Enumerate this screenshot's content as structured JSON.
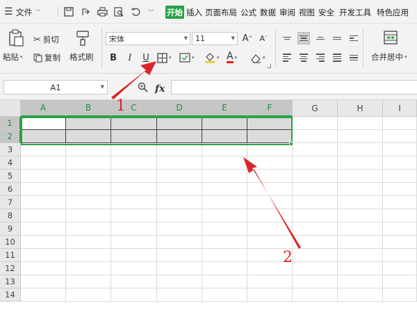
{
  "menubar": {
    "file_label": "文件",
    "tabs": [
      "开始",
      "插入",
      "页面布局",
      "公式",
      "数据",
      "审阅",
      "视图",
      "安全",
      "开发工具",
      "特色应用"
    ],
    "active_tab": "开始"
  },
  "ribbon": {
    "paste_label": "粘贴",
    "cut_label": "剪切",
    "copy_label": "复制",
    "format_painter_label": "格式刷",
    "font_name": "宋体",
    "font_size": "11",
    "bold": "B",
    "italic": "I",
    "underline": "U",
    "font_color_glyph": "A",
    "font_color": "#e02020",
    "merge_label": "合并居中"
  },
  "formula_bar": {
    "name_box": "A1",
    "fx_label": "fx",
    "formula": ""
  },
  "sheet": {
    "columns": [
      "A",
      "B",
      "C",
      "D",
      "E",
      "F",
      "G",
      "H",
      "I"
    ],
    "rows": [
      "1",
      "2",
      "3",
      "4",
      "5",
      "6",
      "7",
      "8",
      "9",
      "10",
      "11",
      "12",
      "13",
      "14"
    ],
    "selected_columns": [
      "A",
      "B",
      "C",
      "D",
      "E",
      "F"
    ],
    "selected_rows": [
      "1",
      "2"
    ],
    "active_cell": "A1"
  },
  "annotations": {
    "label_1": "1",
    "label_2": "2",
    "color": "#d8262a"
  },
  "colors": {
    "accent": "#25a244",
    "selection_fill": "#dcdcdc"
  }
}
